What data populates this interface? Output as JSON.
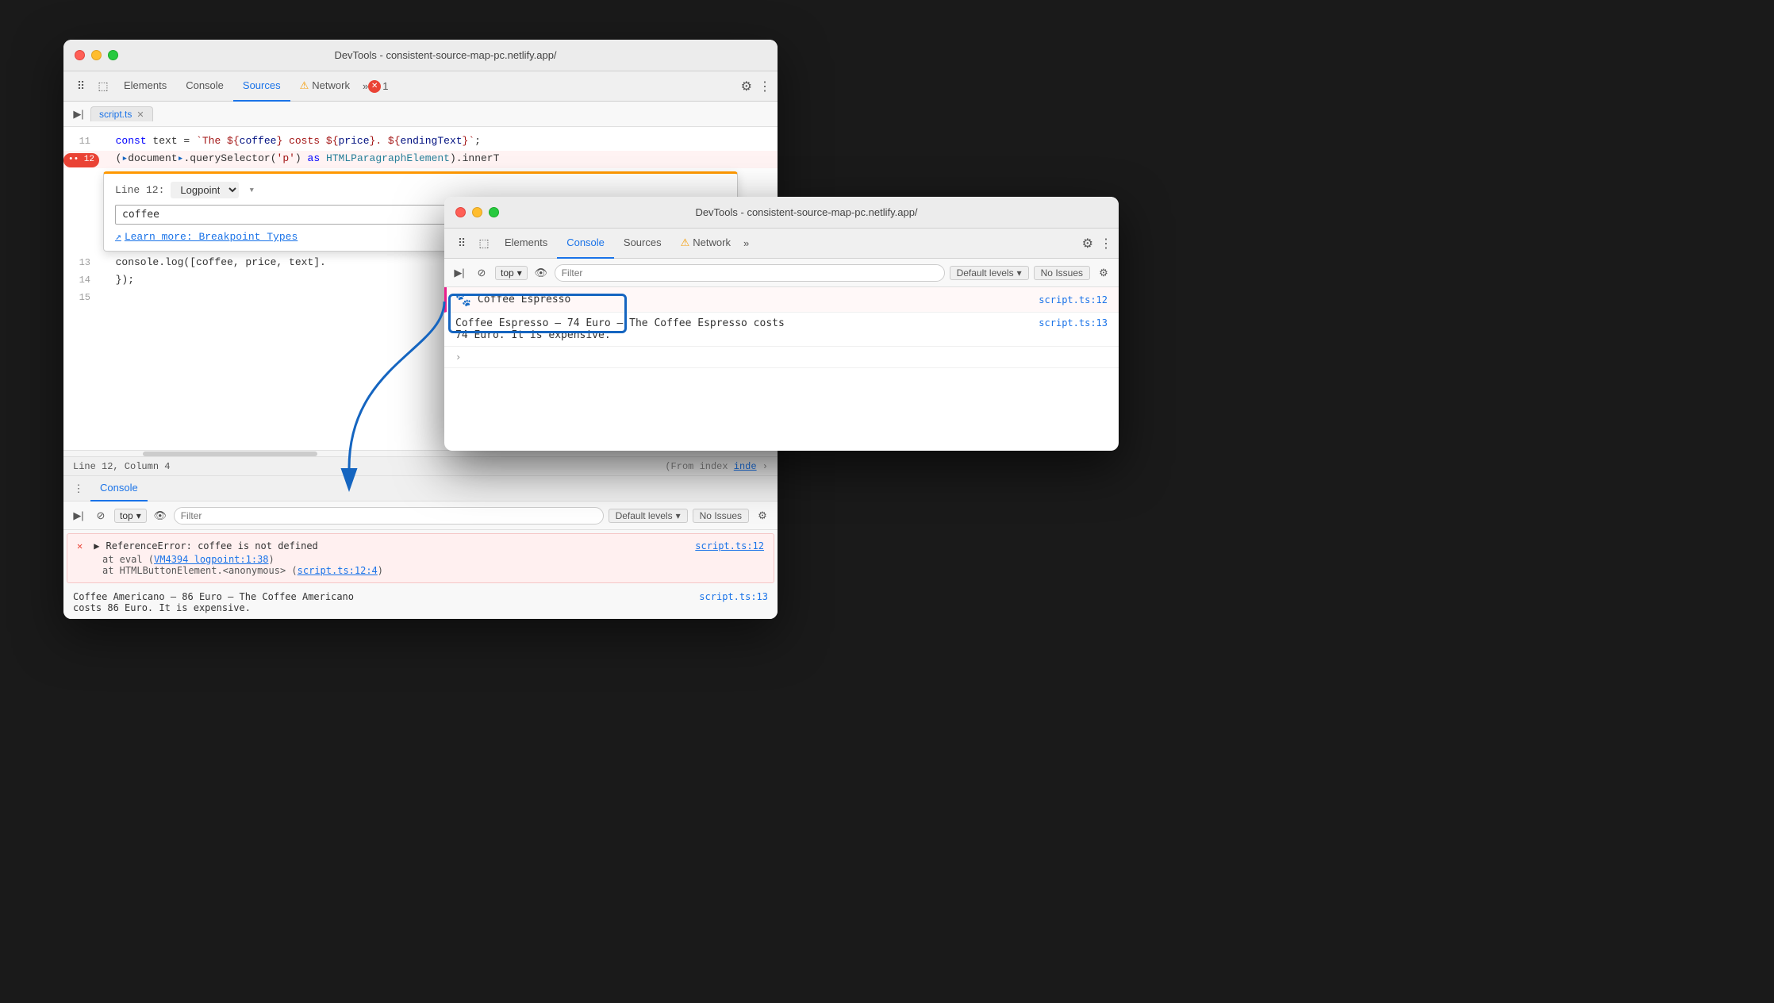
{
  "back_window": {
    "title": "DevTools - consistent-source-map-pc.netlify.app/",
    "tabs": [
      "Elements",
      "Console",
      "Sources",
      "Network"
    ],
    "active_tab": "Sources",
    "file_tab": "script.ts",
    "error_count": "1",
    "lines": [
      {
        "num": "11",
        "content": "  const text = `The ${coffee} costs ${price}. ${endingText}`;"
      },
      {
        "num": "12",
        "content": "  (document.querySelector('p') as HTMLParagraphElement).innerT",
        "breakpoint": true
      },
      {
        "num": "13",
        "content": "  console.log([coffee, price, text]."
      },
      {
        "num": "14",
        "content": "  });"
      },
      {
        "num": "15",
        "content": ""
      }
    ],
    "logpoint": {
      "line_label": "Line 12:",
      "type": "Logpoint",
      "input_value": "coffee"
    },
    "learn_more": "Learn more: Breakpoint Types",
    "status": {
      "line_col": "Line 12, Column 4",
      "from": "(From index"
    },
    "console_tab_label": "Console",
    "console_toolbar": {
      "top_label": "top",
      "filter_placeholder": "Filter",
      "default_levels": "Default levels",
      "no_issues": "No Issues"
    },
    "error_message": {
      "text": "ReferenceError: coffee is not defined",
      "detail1": "  at eval (VM4394 logpoint:1:38)",
      "detail2": "  at HTMLButtonElement.<anonymous> (script.ts:12:4)",
      "link1": "script.ts:12",
      "vm_link": "VM4394 logpoint:1:38",
      "script_link": "script.ts:12:4"
    },
    "log_americano": {
      "text": "Coffee Americano – 86 Euro – The Coffee Americano\ncosts 86 Euro. It is expensive.",
      "link": "script.ts:13"
    }
  },
  "front_window": {
    "title": "DevTools - consistent-source-map-pc.netlify.app/",
    "tabs": [
      "Elements",
      "Console",
      "Sources",
      "Network"
    ],
    "active_tab": "Console",
    "console_toolbar": {
      "top_label": "top",
      "filter_placeholder": "Filter",
      "default_levels": "Default levels",
      "no_issues": "No Issues"
    },
    "espresso_row": {
      "text": "Coffee Espresso",
      "link": "script.ts:12"
    },
    "log_espresso": {
      "text": "Coffee Espresso – 74 Euro – The Coffee Espresso costs\n74 Euro. It is expensive.",
      "link": "script.ts:13"
    },
    "expand_symbol": "›"
  },
  "icons": {
    "panel_icon": "⠿",
    "device_icon": "⬚",
    "cursor_icon": "⋮",
    "sidebar_icon": "▶|",
    "block_icon": "⊘",
    "eye_icon": "👁",
    "gear_icon": "⚙",
    "more_icon": "⋮",
    "warning_icon": "⚠",
    "link_icon": "↗",
    "chevron_down": "▾",
    "triangle_right": "▶",
    "espresso_icon": "🐾"
  }
}
